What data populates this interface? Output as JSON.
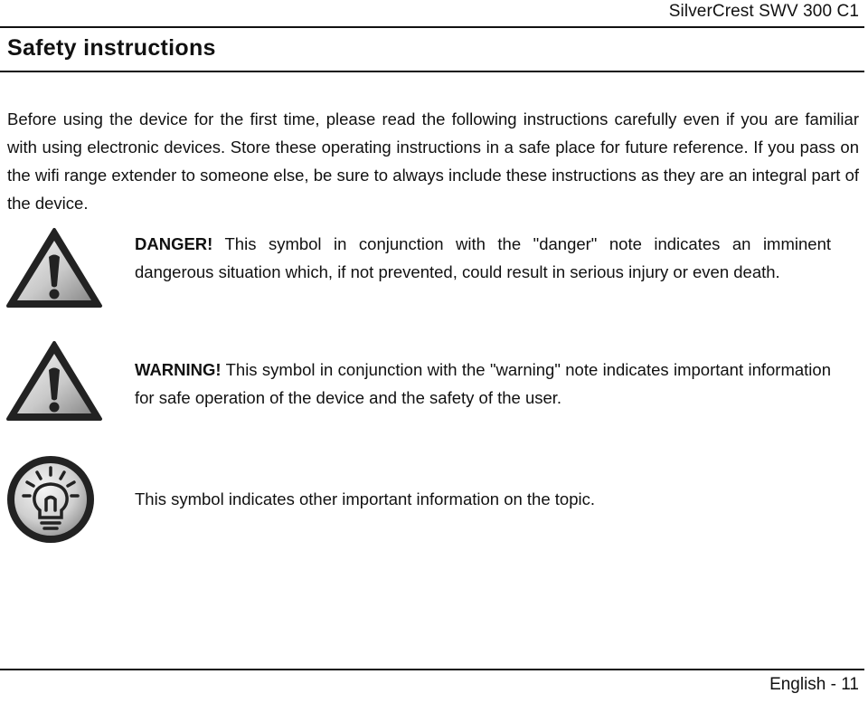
{
  "header": {
    "model": "SilverCrest SWV 300 C1"
  },
  "section": {
    "title": "Safety instructions"
  },
  "intro": {
    "text": "Before using the device for the first time, please read the following instructions carefully even if you are familiar with using electronic devices. Store these operating instructions in a safe place for future reference. If you pass on the wifi range extender to someone else, be sure to always include these instructions as they are an integral part of the device."
  },
  "notes": [
    {
      "icon": "warning-triangle-icon",
      "label": "DANGER!",
      "text": " This symbol in conjunction with the \"danger\" note indicates an imminent dangerous situation which, if not prevented, could result in serious injury or even death."
    },
    {
      "icon": "warning-triangle-icon",
      "label": "WARNING!",
      "text": " This symbol in conjunction with the \"warning\" note indicates important information for safe operation of the device and the safety of the user."
    },
    {
      "icon": "lightbulb-icon",
      "label": "",
      "text": "This symbol indicates other important information on the topic."
    }
  ],
  "footer": {
    "page_label": "English - 11"
  }
}
